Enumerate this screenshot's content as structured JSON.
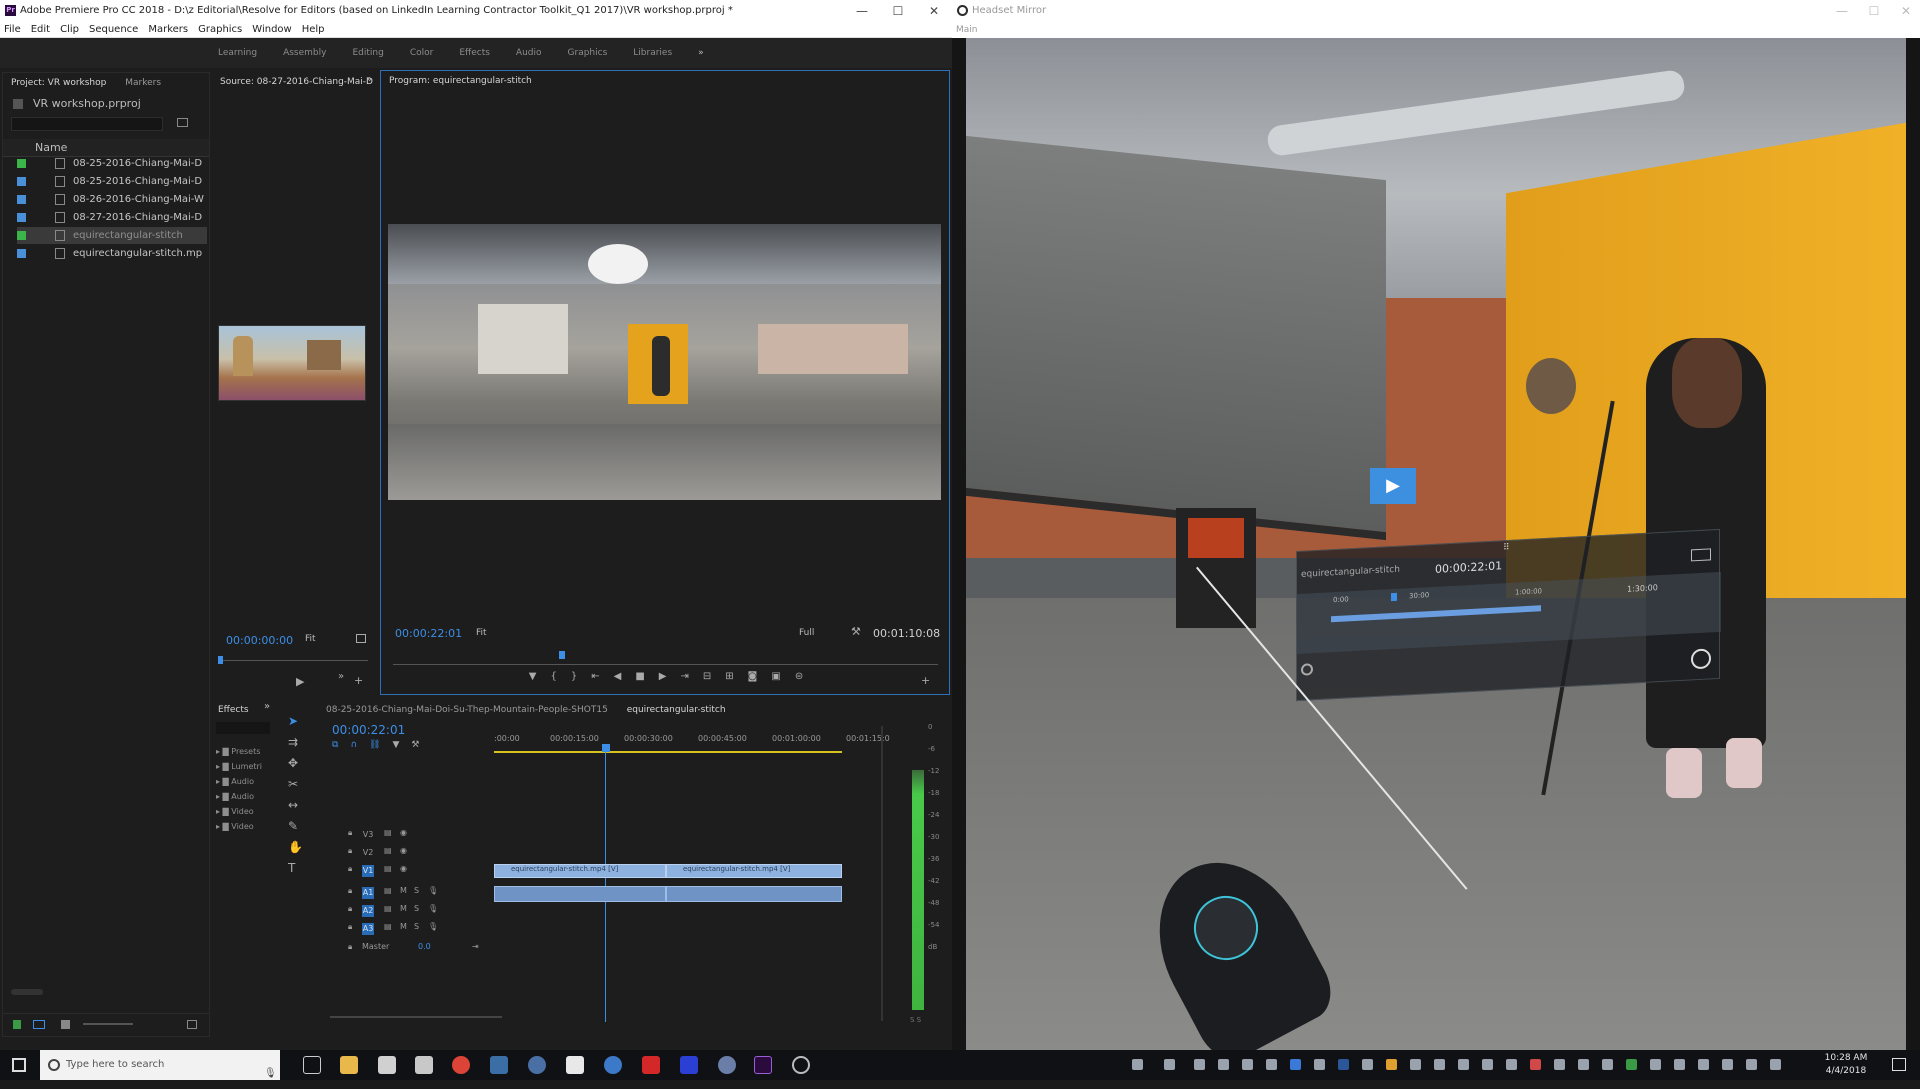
{
  "premiere": {
    "title": "Adobe Premiere Pro CC 2018 - D:\\z Editorial\\Resolve for Editors (based on LinkedIn Learning Contractor Toolkit_Q1 2017)\\VR workshop.prproj *",
    "menu": [
      "File",
      "Edit",
      "Clip",
      "Sequence",
      "Markers",
      "Graphics",
      "Window",
      "Help"
    ],
    "workspaces": [
      "Learning",
      "Assembly",
      "Editing",
      "Color",
      "Effects",
      "Audio",
      "Graphics",
      "Libraries"
    ],
    "project": {
      "tabs": [
        "Project: VR workshop",
        "Markers"
      ],
      "file": "VR workshop.prproj",
      "column_name": "Name",
      "items": [
        {
          "label": "08-25-2016-Chiang-Mai-D",
          "color": "#3bb54a"
        },
        {
          "label": "08-25-2016-Chiang-Mai-D",
          "color": "#4a90d9"
        },
        {
          "label": "08-26-2016-Chiang-Mai-W",
          "color": "#4a90d9"
        },
        {
          "label": "08-27-2016-Chiang-Mai-D",
          "color": "#4a90d9"
        },
        {
          "label": "equirectangular-stitch",
          "color": "#3bb54a"
        },
        {
          "label": "equirectangular-stitch.mp",
          "color": "#4a90d9"
        }
      ]
    },
    "source": {
      "tab": "Source: 08-27-2016-Chiang-Mai-D",
      "timecode": "00:00:00:00",
      "fit": "Fit"
    },
    "program": {
      "tab": "Program: equirectangular-stitch",
      "timecode": "00:00:22:01",
      "fit": "Fit",
      "quality": "Full",
      "duration": "00:01:10:08",
      "playhead_fraction": 0.31
    },
    "effects": {
      "tab": "Effects",
      "folders": [
        "Presets",
        "Lumetri",
        "Audio",
        "Audio",
        "Video",
        "Video"
      ]
    },
    "timeline": {
      "tabs": [
        "08-25-2016-Chiang-Mai-Doi-Su-Thep-Mountain-People-SHOT15",
        "equirectangular-stitch"
      ],
      "timecode": "00:00:22:01",
      "ruler": [
        ":00:00",
        "00:00:15:00",
        "00:00:30:00",
        "00:00:45:00",
        "00:01:00:00",
        "00:01:15:0"
      ],
      "video_tracks": [
        "V3",
        "V2",
        "V1"
      ],
      "audio_tracks": [
        "A1",
        "A2",
        "A3"
      ],
      "master_label": "Master",
      "master_value": "0.0",
      "clip_label": "equirectangular-stitch.mp4 [V]",
      "meter_scale": [
        "0",
        "-6",
        "-12",
        "-18",
        "-24",
        "-30",
        "-36",
        "-42",
        "-48",
        "-54",
        "dB"
      ],
      "meter_footer": "S S"
    }
  },
  "headset": {
    "title": "Headset Mirror",
    "subtitle": "Main",
    "overlay_name": "equirectangular-stitch",
    "overlay_time": "00:00:22:01",
    "overlay_ticks": [
      "0:00",
      "30:00",
      "1:00:00",
      "1:30:00"
    ]
  },
  "taskbar": {
    "search_placeholder": "Type here to search",
    "time": "10:28 AM",
    "date": "4/4/2018"
  }
}
